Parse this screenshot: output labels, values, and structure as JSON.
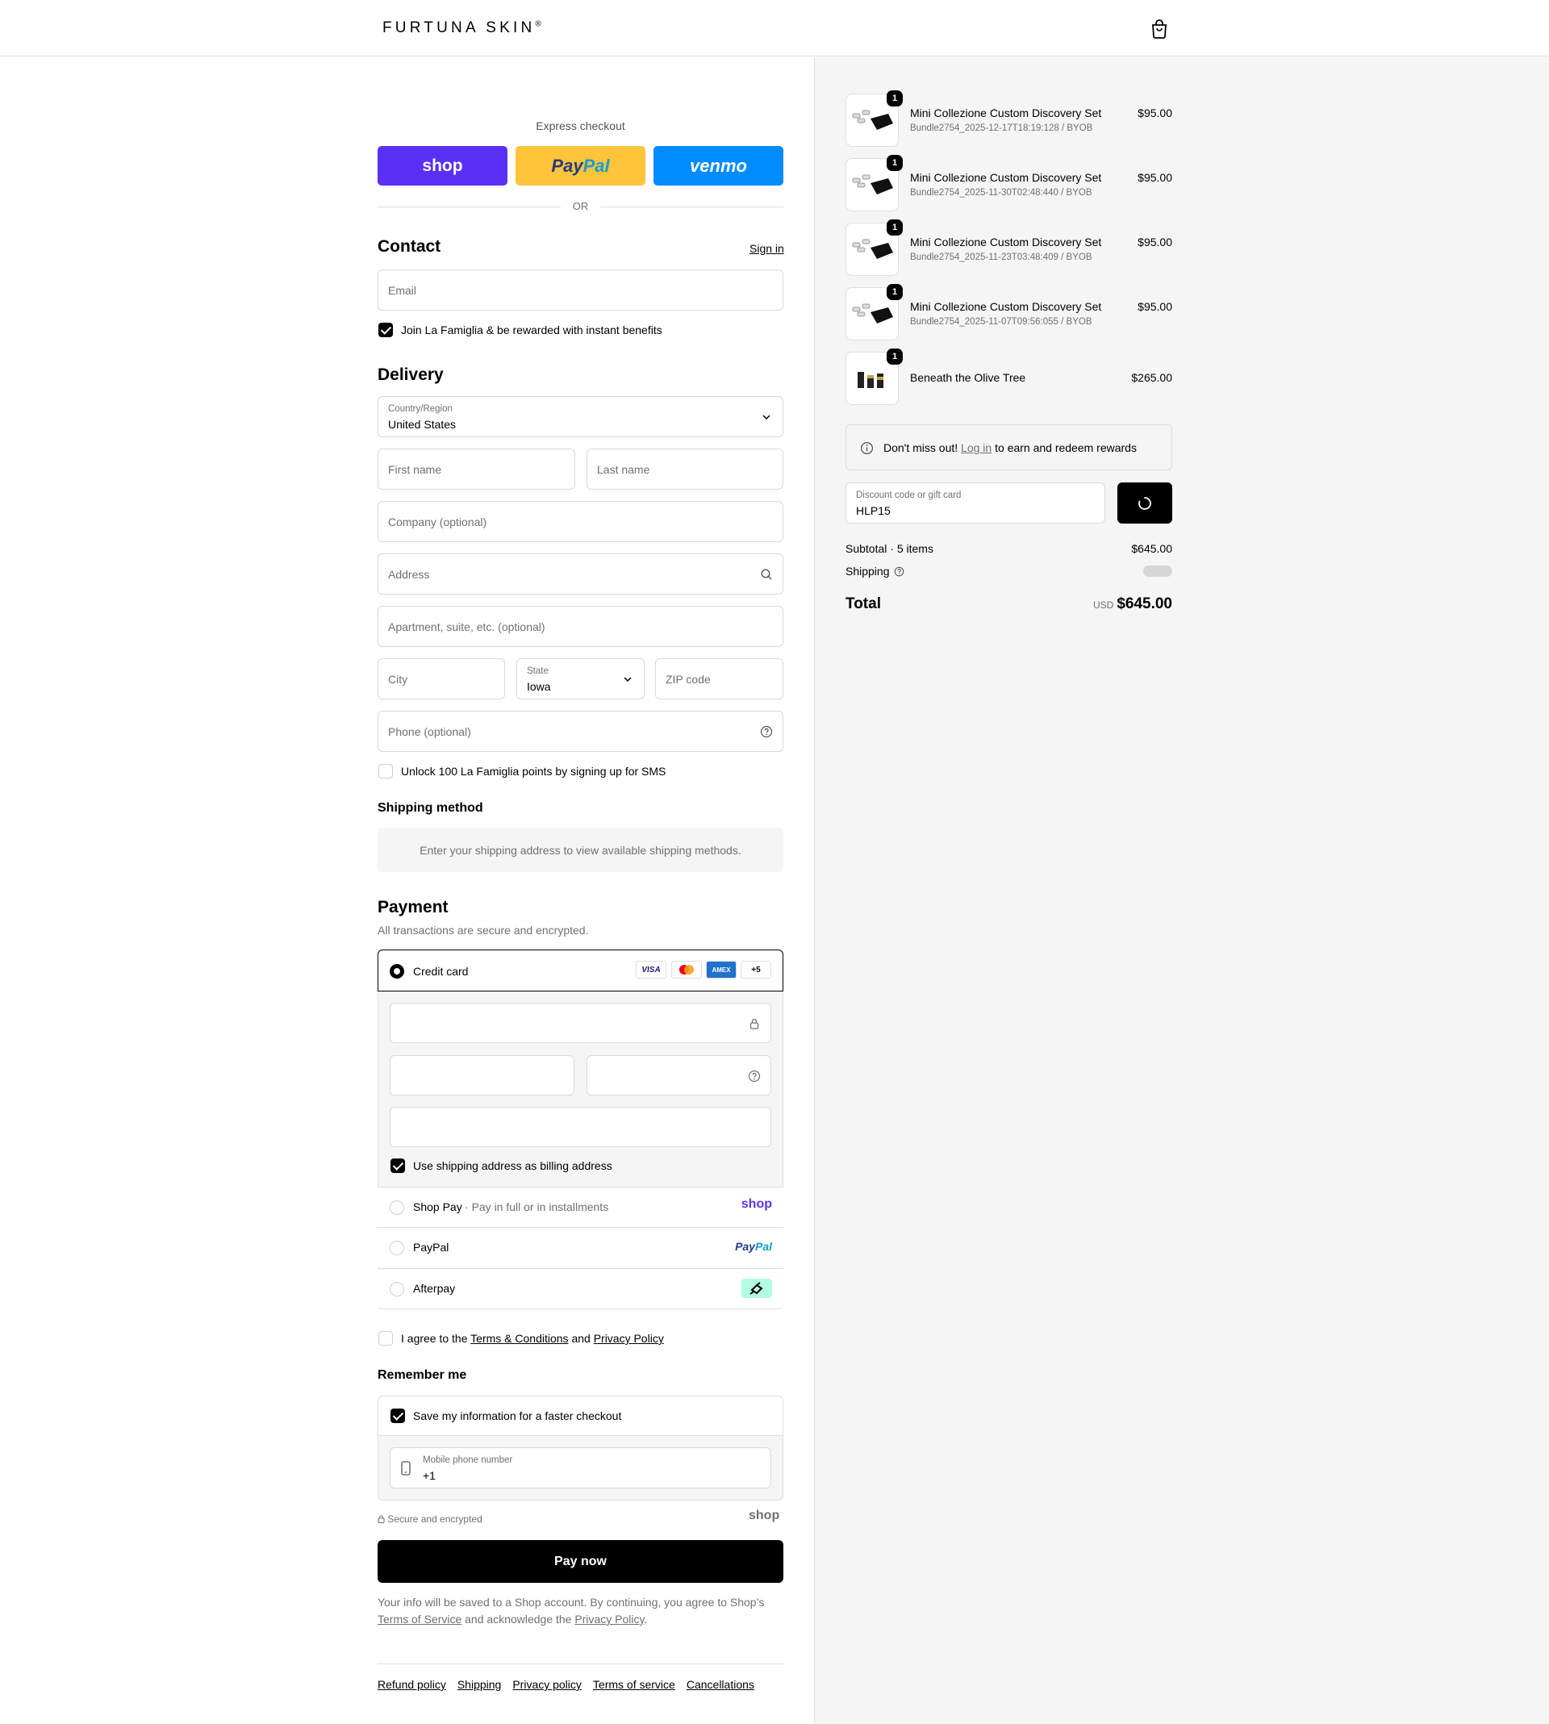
{
  "brand": {
    "name": "FURTUNA SKIN",
    "mark": "®"
  },
  "express": {
    "title": "Express checkout",
    "shop_label": "shop",
    "paypal_label_a": "Pay",
    "paypal_label_b": "Pal",
    "venmo_label": "venmo",
    "or_label": "OR"
  },
  "contact": {
    "title": "Contact",
    "sign_in": "Sign in",
    "email_placeholder": "Email",
    "join_label": "Join La Famiglia & be rewarded with instant benefits"
  },
  "delivery": {
    "title": "Delivery",
    "country_label": "Country/Region",
    "country_value": "United States",
    "first_name": "First name",
    "last_name": "Last name",
    "company": "Company (optional)",
    "address": "Address",
    "apartment": "Apartment, suite, etc. (optional)",
    "city": "City",
    "state_label": "State",
    "state_value": "Iowa",
    "zip": "ZIP code",
    "phone": "Phone (optional)",
    "sms_label": "Unlock 100 La Famiglia points by signing up for SMS"
  },
  "shipping_method": {
    "title": "Shipping method",
    "notice": "Enter your shipping address to view available shipping methods."
  },
  "payment": {
    "title": "Payment",
    "subtitle": "All transactions are secure and encrypted.",
    "credit_card": "Credit card",
    "card_brands": [
      "VISA",
      "",
      "AMEX",
      "+5"
    ],
    "billing_label": "Use shipping address as billing address",
    "shop_pay": "Shop Pay",
    "shop_pay_sub": "Pay in full or in installments",
    "shop_pay_logo": "shop",
    "paypal": "PayPal",
    "paypal_logo_a": "Pay",
    "paypal_logo_b": "Pal",
    "afterpay": "Afterpay"
  },
  "agree": {
    "prefix": "I agree to the",
    "terms": "Terms & Conditions",
    "and": "and",
    "privacy": "Privacy Policy"
  },
  "remember": {
    "title": "Remember me",
    "save_label": "Save my information for a faster checkout",
    "mobile_label": "Mobile phone number",
    "mobile_value": "+1",
    "secure": "Secure and encrypted",
    "shop_logo": "shop"
  },
  "pay_button": "Pay now",
  "disclaimer": {
    "line1": "Your info will be saved to a Shop account. By continuing, you agree to Shop’s",
    "tos": "Terms of Service",
    "mid": "and acknowledge the",
    "privacy": "Privacy Policy",
    "end": "."
  },
  "footer_links": [
    "Refund policy",
    "Shipping",
    "Privacy policy",
    "Terms of service",
    "Cancellations"
  ],
  "cart": {
    "items": [
      {
        "qty": "1",
        "name": "Mini Collezione Custom Discovery Set",
        "variant": "Bundle2754_2025-12-17T18:19:128 / BYOB",
        "price": "$95.00"
      },
      {
        "qty": "1",
        "name": "Mini Collezione Custom Discovery Set",
        "variant": "Bundle2754_2025-11-30T02:48:440 / BYOB",
        "price": "$95.00"
      },
      {
        "qty": "1",
        "name": "Mini Collezione Custom Discovery Set",
        "variant": "Bundle2754_2025-11-23T03:48:409 / BYOB",
        "price": "$95.00"
      },
      {
        "qty": "1",
        "name": "Mini Collezione Custom Discovery Set",
        "variant": "Bundle2754_2025-11-07T09:56:055 / BYOB",
        "price": "$95.00"
      },
      {
        "qty": "1",
        "name": "Beneath the Olive Tree",
        "variant": "",
        "price": "$265.00"
      }
    ],
    "rewards_prefix": "Don't miss out!",
    "rewards_link": "Log in",
    "rewards_suffix": "to earn and redeem rewards",
    "discount_label": "Discount code or gift card",
    "discount_value": "HLP15",
    "subtotal_label": "Subtotal · 5 items",
    "subtotal_value": "$645.00",
    "shipping_label": "Shipping",
    "total_label": "Total",
    "currency": "USD",
    "total_value": "$645.00"
  },
  "colors": {
    "shop": "#5a31f4",
    "paypal": "#ffc439",
    "venmo": "#008cff",
    "afterpay": "#b2fce4"
  }
}
